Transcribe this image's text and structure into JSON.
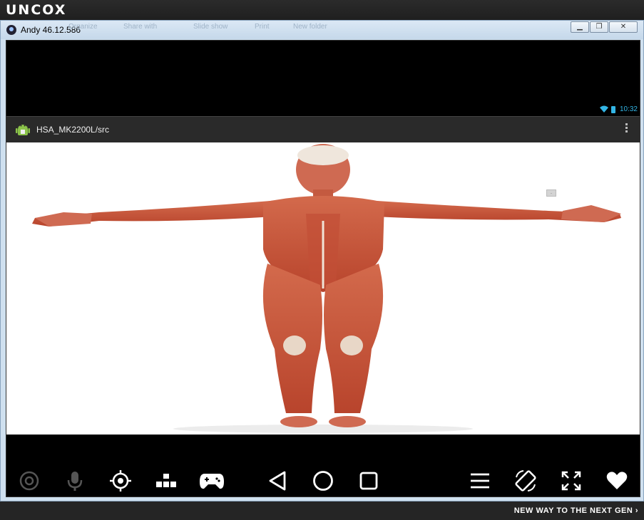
{
  "brand": {
    "logo": "UNCOX"
  },
  "window": {
    "title": "Andy 46.12.586",
    "ghost_menu": [
      "Organize",
      "Share with",
      "Slide show",
      "Print",
      "New folder"
    ]
  },
  "status": {
    "time": "10:32"
  },
  "actionbar": {
    "title": "HSA_MK2200L/src"
  },
  "viewer": {
    "marker": "."
  },
  "navbar": {
    "icons": [
      "camera-icon",
      "mic-icon",
      "location-icon",
      "keyboard-icon",
      "gamepad-icon",
      "back-icon",
      "home-icon",
      "recents-icon",
      "menu-icon",
      "rotate-icon",
      "fullscreen-icon",
      "heart-icon"
    ]
  },
  "footer": {
    "tagline": "NEW WAY TO THE NEXT GEN ›"
  },
  "colors": {
    "accent": "#33b5e5",
    "muscle": "#c8553a"
  }
}
